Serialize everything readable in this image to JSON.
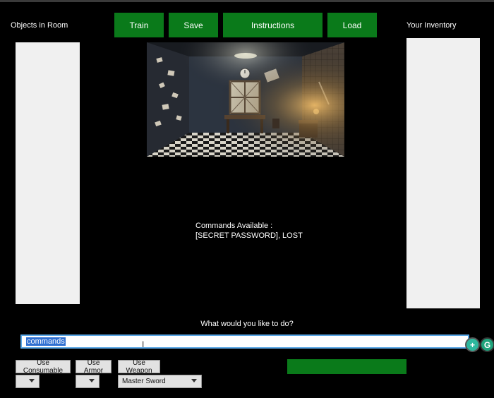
{
  "left_panel": {
    "title": "Objects in Room"
  },
  "right_panel": {
    "title": "Your Inventory"
  },
  "toolbar": {
    "train_label": "Train",
    "save_label": "Save",
    "instructions_label": "Instructions",
    "load_label": "Load"
  },
  "room": {
    "commands_heading": "Commands Available :",
    "commands_list": "[SECRET PASSWORD], LOST"
  },
  "prompt": {
    "question": "What would you like to do?",
    "input_value": "commands"
  },
  "actions": {
    "use_consumable_label": "Use Consumable",
    "use_armor_label": "Use Armor",
    "use_weapon_label": "Use Weapon",
    "consumable_selected": "",
    "armor_selected": "",
    "weapon_selected": "Master Sword"
  },
  "colors": {
    "accent_green": "#0a7a1a",
    "background": "#000000",
    "panel": "#f0f0f0",
    "input_focus": "#5aa7e6"
  },
  "icons": {
    "add": "plus-icon",
    "grammar": "grammar-check-icon",
    "cursor": "text-cursor-icon"
  }
}
